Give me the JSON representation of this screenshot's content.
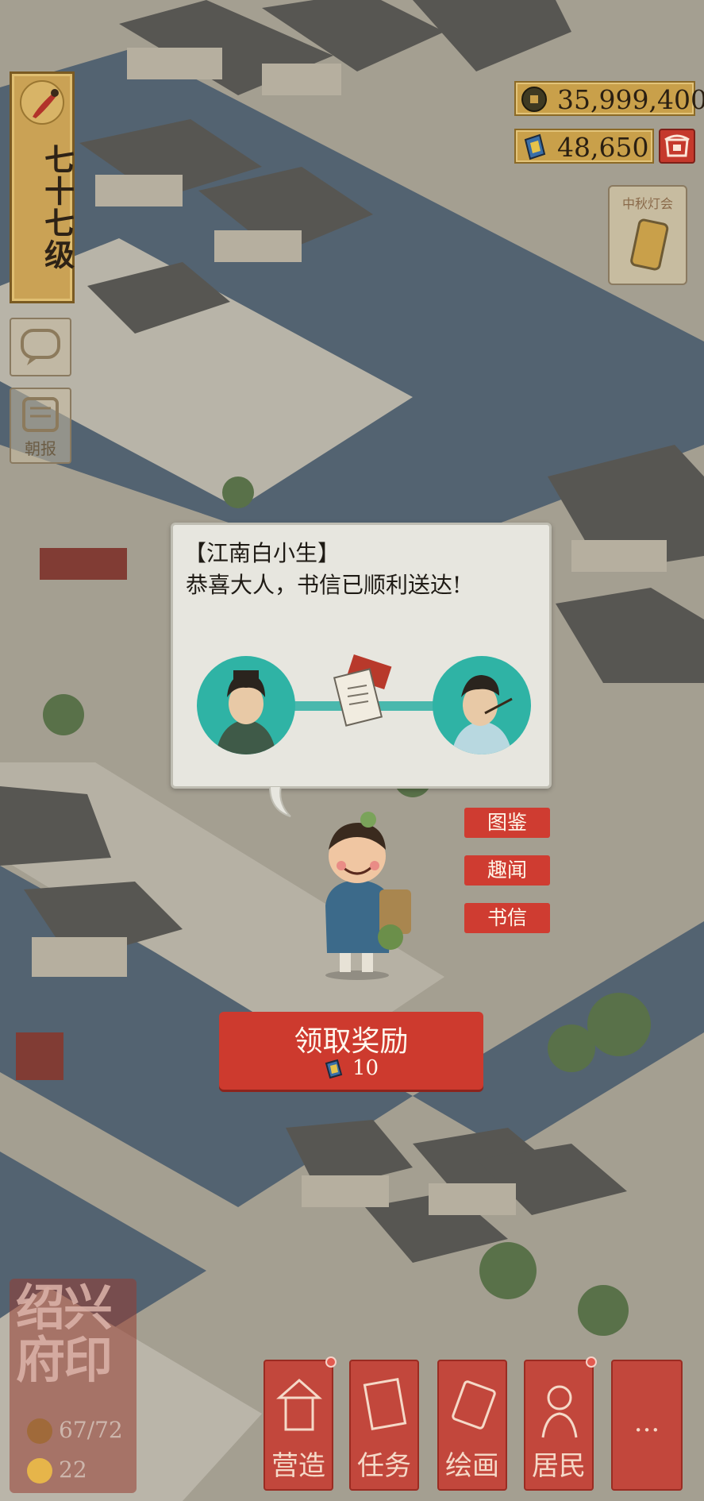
{
  "level": {
    "text": "七十七级"
  },
  "side_buttons": [
    {
      "label": ""
    },
    {
      "label": "朝报"
    }
  ],
  "currency": {
    "coins": "35,999,400",
    "tokens": "48,650"
  },
  "event": {
    "label": "中秋灯会"
  },
  "dialog": {
    "speaker": "【江南白小生】",
    "message": "恭喜大人，书信已顺利送达!"
  },
  "menu": [
    {
      "label": "图鉴"
    },
    {
      "label": "趣闻"
    },
    {
      "label": "书信"
    }
  ],
  "claim": {
    "label": "领取奖励",
    "amount": "10"
  },
  "seal": {
    "title": "绍兴府印",
    "population": "67/72",
    "happiness": "22"
  },
  "toolbar": [
    {
      "label": "营造"
    },
    {
      "label": "任务"
    },
    {
      "label": "绘画"
    },
    {
      "label": "居民"
    },
    {
      "label": "..."
    }
  ],
  "colors": {
    "accent_red": "#cd3a2e",
    "gold": "#c9a04a",
    "teal": "#2fb3a5",
    "canal": "#566a78"
  }
}
